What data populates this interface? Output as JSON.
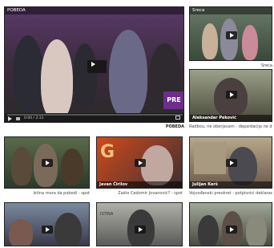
{
  "main_video": {
    "title": "POBEDA",
    "brand_overlay": "PRE",
    "controls": {
      "time": "0:00 / 2:31"
    },
    "caption": "POBEDA"
  },
  "side_videos": [
    {
      "overlay_title": "Sreca",
      "caption": "Sreća"
    },
    {
      "name_line": "Aleksandar Peković",
      "caption": "Radbou, ne oberjavam - depardacija ne dek"
    }
  ],
  "grid_videos": [
    {
      "caption": "Istina mora da pobedi - spot"
    },
    {
      "name_line": "Javan Ćirilov",
      "caption": "Zašto Čedomir Jovanović? - spot"
    },
    {
      "name_line": "Julijan Kerš",
      "caption": "Vojvođanski preokret - potpisnici deklaracije -"
    },
    {
      "caption": ""
    },
    {
      "overlay_title": "ISTINA",
      "caption": ""
    },
    {
      "caption": ""
    }
  ],
  "colors": {
    "main_bg": "#4a2b55",
    "accent": "#6b2f8a"
  }
}
